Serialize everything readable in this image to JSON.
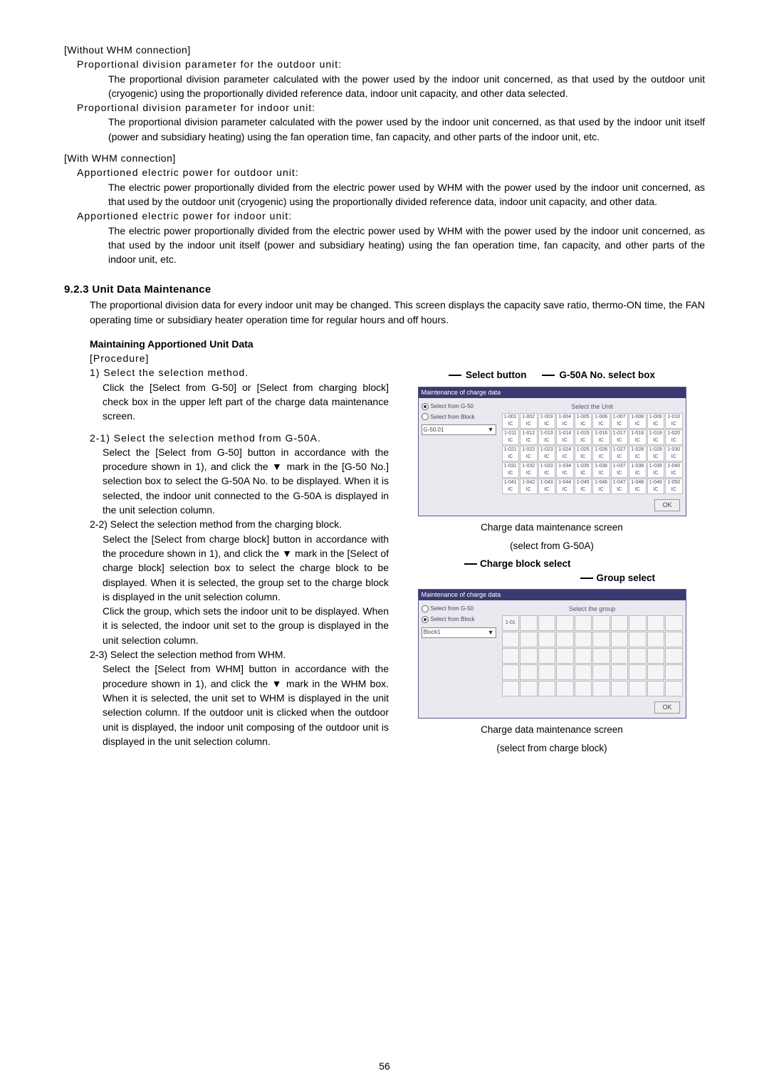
{
  "section_a": {
    "title": "[Without WHM connection]",
    "p1h": "Proportional division parameter for the outdoor unit:",
    "p1b": "The proportional division parameter calculated with the power used by the indoor unit concerned, as that used by the outdoor unit (cryogenic) using the proportionally divided reference data, indoor unit capacity, and other data selected.",
    "p2h": "Proportional division parameter for indoor unit:",
    "p2b": "The proportional division parameter calculated with the power used by the indoor unit concerned, as that used by the indoor unit itself (power and subsidiary heating) using the fan operation time, fan capacity, and other parts of the indoor unit, etc."
  },
  "section_b": {
    "title": "[With WHM connection]",
    "p1h": "Apportioned electric power for outdoor unit:",
    "p1b": "The electric power proportionally divided from the electric power used by WHM with the power used by the indoor unit concerned, as that used by the outdoor unit (cryogenic) using the proportionally divided reference data, indoor unit capacity, and other data.",
    "p2h": "Apportioned electric power for indoor unit:",
    "p2b": "The electric power proportionally divided from the electric power used by WHM with the power used by the indoor unit concerned, as that used by the indoor unit itself (power and subsidiary heating) using the fan operation time, fan capacity, and other parts of the indoor unit, etc."
  },
  "h923": "9.2.3 Unit Data Maintenance",
  "intro": "The proportional division data for every indoor unit may be changed. This screen displays the capacity save ratio, thermo-ON time, the FAN operating time or subsidiary  heater operation time for regular hours and off hours.",
  "maint_head": "Maintaining Apportioned Unit  Data",
  "proc_label": "[Procedure]",
  "step1h": "1) Select the selection method.",
  "step1b": "Click the [Select from G-50] or [Select from charging block] check box in the upper left part of the charge data maintenance screen.",
  "step21h": "2-1) Select the selection method from G-50A.",
  "step21b": "Select the [Select from G-50] button in accordance with the procedure shown in 1), and click the ▼ mark in the [G-50 No.] selection box to select the G-50A No. to be displayed. When it is selected, the indoor unit connected to the G-50A is displayed in the unit selection column.",
  "step22h": "2-2) Select the selection method from the charging block.",
  "step22b1": "Select the [Select from charge block] button in accordance with the procedure shown in 1), and click the ▼ mark in the [Select of charge block] selection box to select the charge block to be displayed. When it is selected, the group set to the charge block is displayed in the unit selection column.",
  "step22b2": "Click the group, which sets the indoor unit to be displayed. When it is selected, the indoor unit set to the group is displayed in the unit selection column.",
  "step23h": "2-3) Select the selection method  from  WHM.",
  "step23b": "Select the [Select from WHM] button in accordance with the procedure shown in 1), and click the ▼ mark in the WHM box. When it is selected, the unit set to WHM is displayed in the unit selection column. If the outdoor unit is clicked when the outdoor unit is displayed, the indoor unit composing of the outdoor unit is displayed in the unit selection column.",
  "call_select_button": "Select button",
  "call_g50a_box": "G-50A No. select box",
  "shot1": {
    "title": "Maintenance of charge data",
    "r1": "Select from G-50",
    "r2": "Select from Block",
    "combo": "G-50.01",
    "grid_title": "Select the Unit",
    "cell_top_prefix": "1-0",
    "cell_sub": "IC",
    "ok": "OK"
  },
  "fig1cap1": "Charge data maintenance screen",
  "fig1cap2": "(select from G-50A)",
  "call_charge_block": "Charge block select",
  "call_group_select": "Group select",
  "shot2": {
    "title": "Maintenance of charge data",
    "r1": "Select from G-50",
    "r2": "Select from Block",
    "combo": "Block1",
    "grid_title": "Select the group",
    "cell_one": "1-01",
    "ok": "OK"
  },
  "fig2cap1": "Charge data maintenance screen",
  "fig2cap2": "(select from charge block)",
  "page_num": "56"
}
